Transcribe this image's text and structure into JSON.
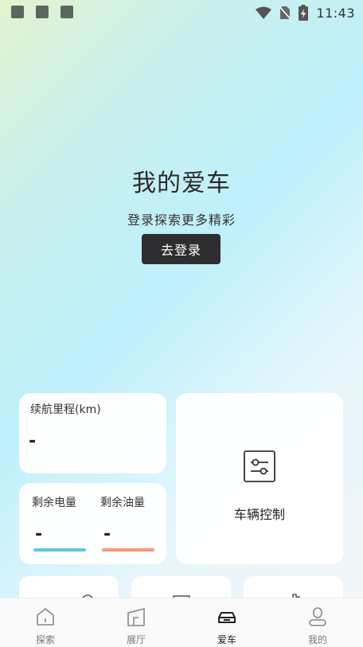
{
  "status_bar": {
    "time": "11:43"
  },
  "hero": {
    "title": "我的爱车",
    "subtitle": "登录探索更多精彩",
    "login_button": "去登录"
  },
  "range_card": {
    "label": "续航里程(km)",
    "value": "-"
  },
  "control_card": {
    "label": "车辆控制",
    "icon": "vehicle-control-icon"
  },
  "energy_card": {
    "battery": {
      "label": "剩余电量",
      "value": "-",
      "color": "#5bc8e6"
    },
    "fuel": {
      "label": "剩余油量",
      "value": "-",
      "color": "#f59a73"
    }
  },
  "tabs": [
    {
      "label": "探索",
      "icon": "home-icon",
      "active": false
    },
    {
      "label": "展厅",
      "icon": "showroom-icon",
      "active": false
    },
    {
      "label": "爱车",
      "icon": "car-icon",
      "active": true
    },
    {
      "label": "我的",
      "icon": "profile-icon",
      "active": false
    }
  ]
}
